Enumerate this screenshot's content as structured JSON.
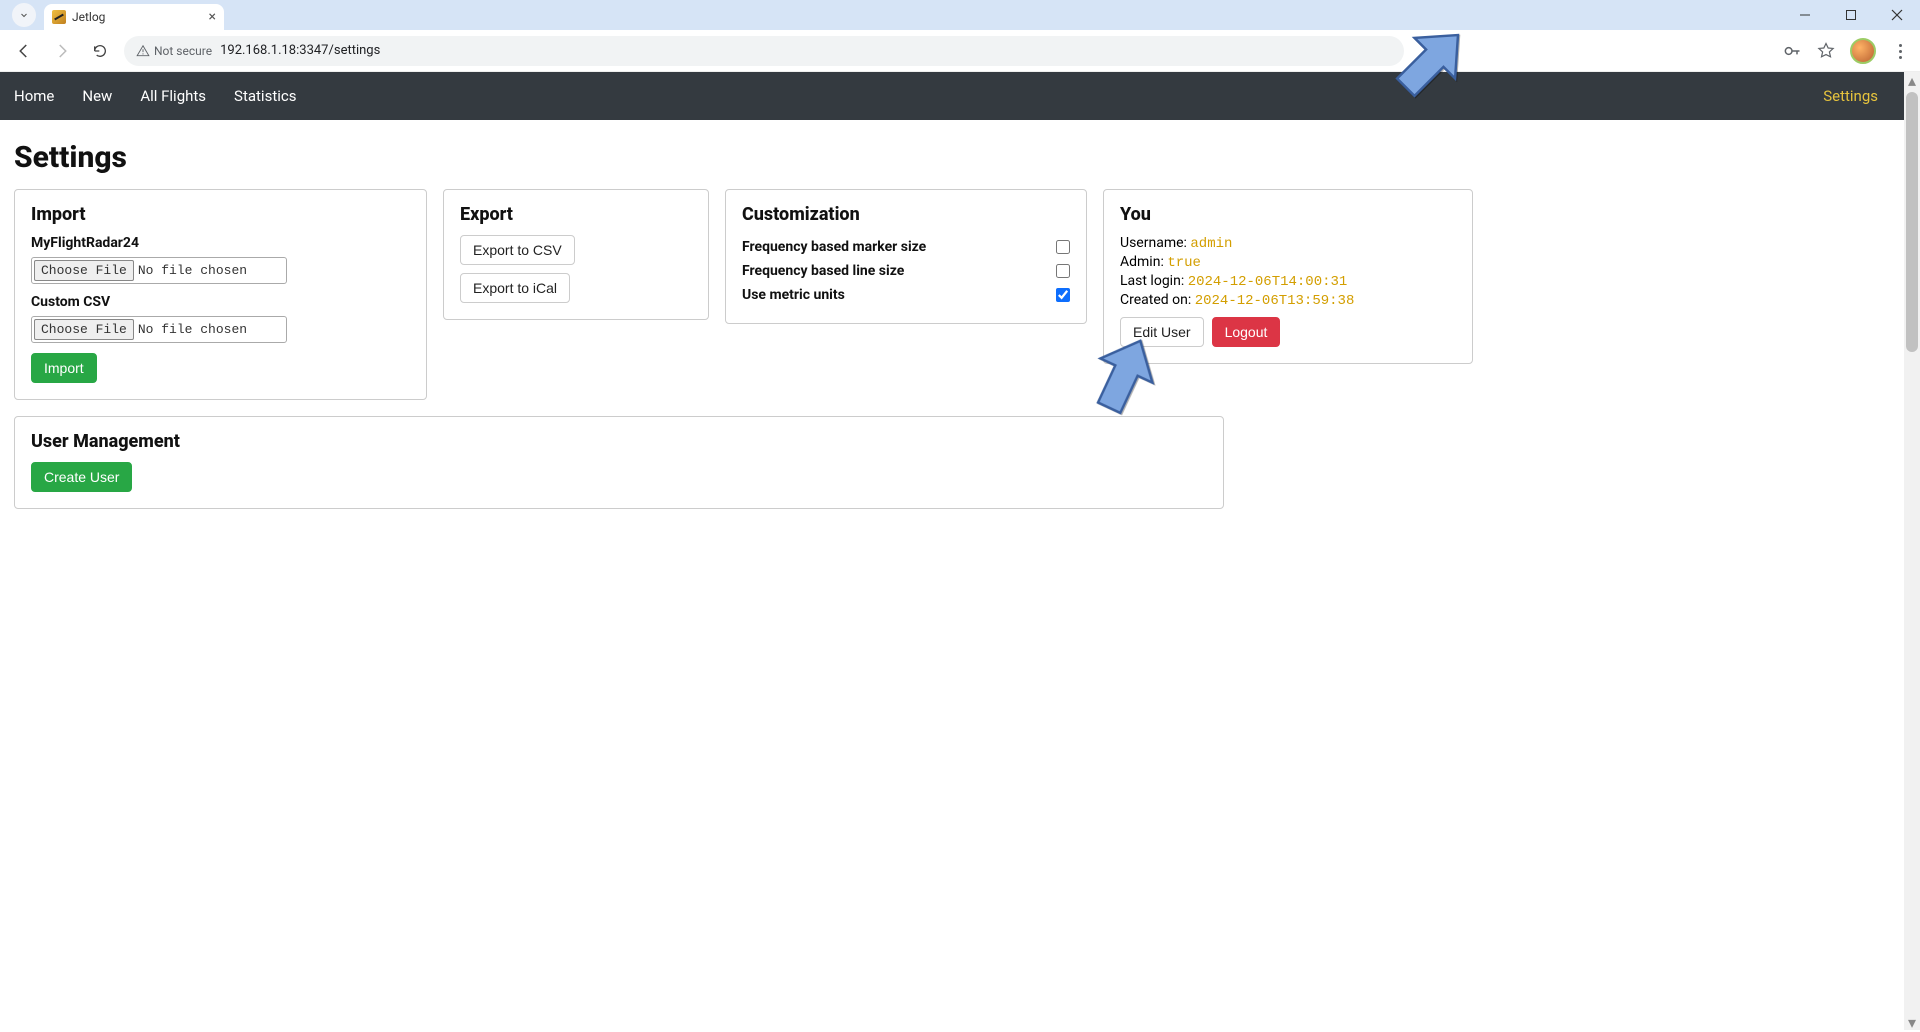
{
  "browser": {
    "tab_title": "Jetlog",
    "url_security_label": "Not secure",
    "url": "192.168.1.18:3347/settings"
  },
  "nav": {
    "items": [
      "Home",
      "New",
      "All Flights",
      "Statistics"
    ],
    "settings": "Settings"
  },
  "page": {
    "title": "Settings"
  },
  "import": {
    "heading": "Import",
    "source1_label": "MyFlightRadar24",
    "source2_label": "Custom CSV",
    "choose_label": "Choose File",
    "no_file_label": "No file chosen",
    "import_btn": "Import"
  },
  "export": {
    "heading": "Export",
    "csv_btn": "Export to CSV",
    "ical_btn": "Export to iCal"
  },
  "custom": {
    "heading": "Customization",
    "opt_marker": "Frequency based marker size",
    "opt_line": "Frequency based line size",
    "opt_metric": "Use metric units",
    "marker_checked": false,
    "line_checked": false,
    "metric_checked": true
  },
  "you": {
    "heading": "You",
    "username_label": "Username: ",
    "username_value": "admin",
    "admin_label": "Admin: ",
    "admin_value": "true",
    "lastlogin_label": "Last login: ",
    "lastlogin_value": "2024-12-06T14:00:31",
    "created_label": "Created on: ",
    "created_value": "2024-12-06T13:59:38",
    "edit_btn": "Edit User",
    "logout_btn": "Logout"
  },
  "usermgmt": {
    "heading": "User Management",
    "create_btn": "Create User"
  }
}
